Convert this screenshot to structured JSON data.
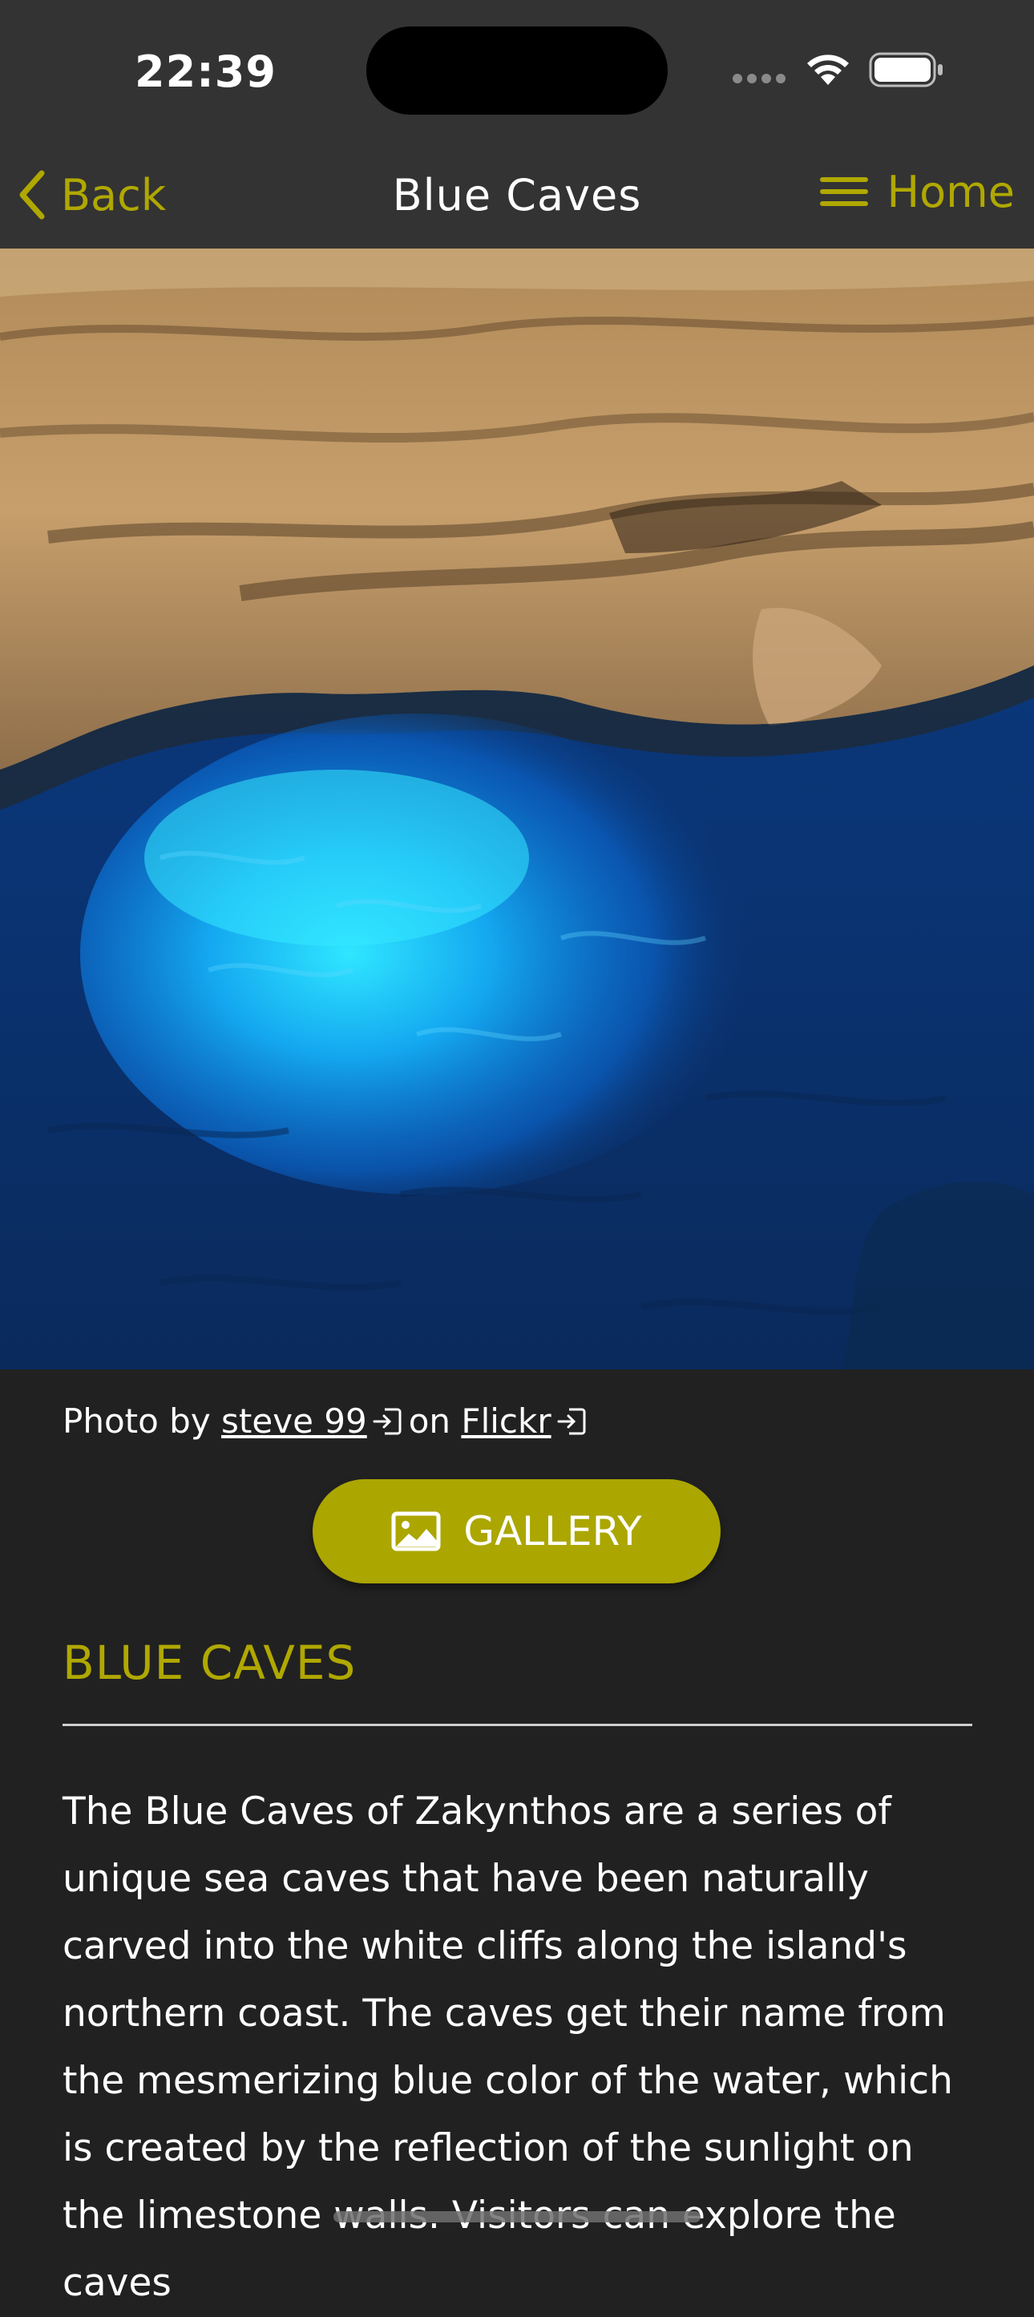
{
  "status_bar": {
    "time": "22:39"
  },
  "nav": {
    "back_label": "Back",
    "title": "Blue Caves",
    "home_label": "Home"
  },
  "photo_credit": {
    "prefix": "Photo by",
    "author": "steve 99",
    "middle": "on",
    "source": "Flickr"
  },
  "gallery_button": {
    "label": "GALLERY"
  },
  "section": {
    "title": "BLUE CAVES",
    "body": "The Blue Caves of Zakynthos are a series of unique sea caves that have been naturally carved into the white cliffs along the island's northern coast. The caves get their name from the mesmerizing blue color of the water, which is created by the reflection of the sunlight on the limestone walls. Visitors can explore the caves"
  },
  "colors": {
    "accent": "#b0a800",
    "button": "#aba600",
    "background": "#212121",
    "bar": "#333333"
  },
  "icons": {
    "back": "chevron-left-icon",
    "menu": "hamburger-menu-icon",
    "external": "external-link-icon",
    "gallery": "image-icon"
  }
}
